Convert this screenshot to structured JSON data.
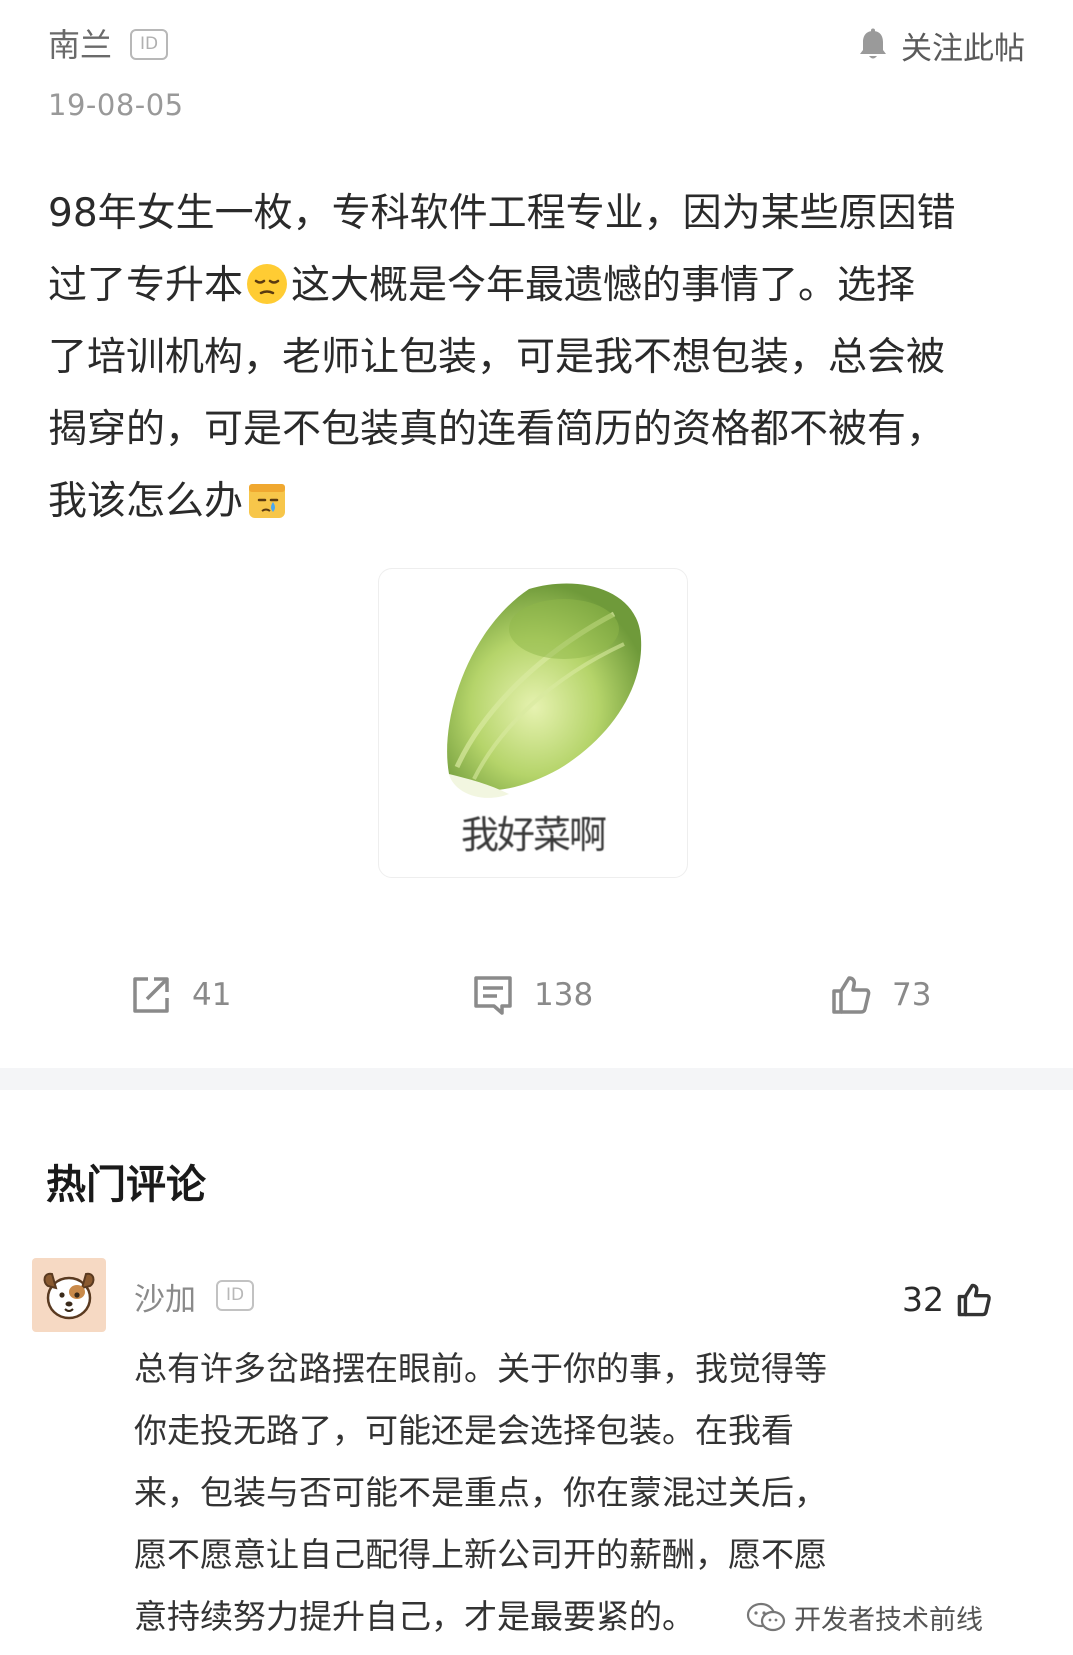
{
  "header": {
    "author": "南兰",
    "id_badge": "ID",
    "follow_label": "关注此帖",
    "date": "19-08-05"
  },
  "post": {
    "lines": [
      "98年女生一枚，专科软件工程专业，因为某些原因错",
      "过了专升本",
      "这大概是今年最遗憾的事情了。选择",
      "了培训机构，老师让包装，可是我不想包装，总会被",
      "揭穿的，可是不包装真的连看简历的资格都不被有，",
      "我该怎么办"
    ],
    "sticker_caption": "我好菜啊"
  },
  "actions": {
    "share_count": "41",
    "comment_count": "138",
    "like_count": "73"
  },
  "comments_section": {
    "title": "热门评论",
    "items": [
      {
        "author": "沙加",
        "id_badge": "ID",
        "likes": "32",
        "lines": [
          "总有许多岔路摆在眼前。关于你的事，我觉得等",
          "你走投无路了，可能还是会选择包装。在我看",
          "来，包装与否可能不是重点，你在蒙混过关后，",
          "愿不愿意让自己配得上新公司开的薪酬，愿不愿",
          "意持续努力提升自己，才是最要紧的。"
        ]
      }
    ]
  },
  "watermark": {
    "text": "开发者技术前线"
  }
}
